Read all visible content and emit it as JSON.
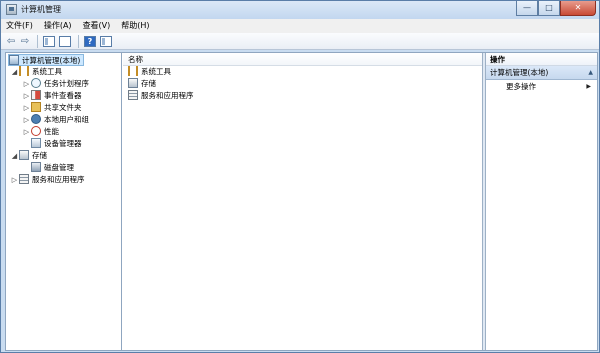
{
  "window": {
    "title": "计算机管理",
    "icon": "computer-management-icon"
  },
  "caption": {
    "minimize": "—",
    "maximize": "□",
    "close": "✕"
  },
  "menu": [
    "文件(F)",
    "操作(A)",
    "查看(V)",
    "帮助(H)"
  ],
  "toolbar": {
    "back": "⇦",
    "forward": "⇨",
    "help": "?"
  },
  "tree": {
    "root": "计算机管理(本地)",
    "system_tools": "系统工具",
    "items": [
      {
        "label": "任务计划程序",
        "icon": "clock-icon"
      },
      {
        "label": "事件查看器",
        "icon": "event-viewer-icon"
      },
      {
        "label": "共享文件夹",
        "icon": "shared-folder-icon"
      },
      {
        "label": "本地用户和组",
        "icon": "users-icon"
      },
      {
        "label": "性能",
        "icon": "performance-icon"
      },
      {
        "label": "设备管理器",
        "icon": "device-manager-icon"
      }
    ],
    "storage": "存储",
    "disk": "磁盘管理",
    "services": "服务和应用程序"
  },
  "list": {
    "column": "名称",
    "rows": [
      "系统工具",
      "存储",
      "服务和应用程序"
    ]
  },
  "actions": {
    "header": "操作",
    "group": "计算机管理(本地)",
    "more": "更多操作"
  }
}
